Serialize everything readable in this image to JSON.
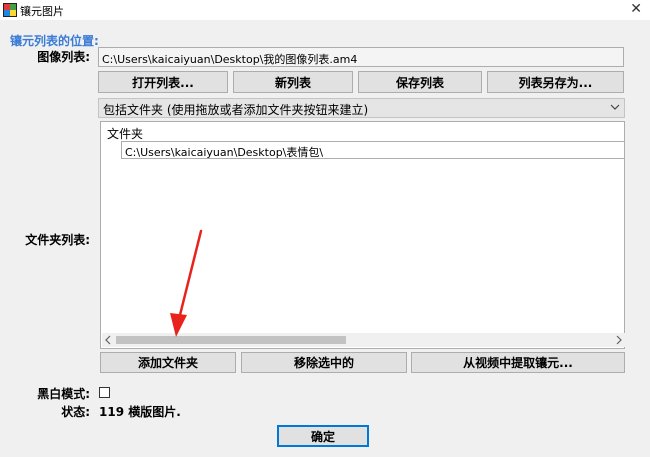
{
  "window": {
    "title": "镶元图片",
    "close_glyph": "✕"
  },
  "group_label": "镶元列表的位置:",
  "image_list": {
    "label": "图像列表:",
    "path": "C:\\Users\\kaicaiyuan\\Desktop\\我的图像列表.am4"
  },
  "list_buttons": {
    "open": "打开列表...",
    "new": "新列表",
    "save": "保存列表",
    "save_as": "列表另存为..."
  },
  "folder_combo": {
    "selected": "包括文件夹 (使用拖放或者添加文件夹按钮来建立)"
  },
  "folder_list": {
    "label": "文件夹列表:",
    "column_header": "文件夹",
    "rows": [
      "C:\\Users\\kaicaiyuan\\Desktop\\表情包\\"
    ]
  },
  "folder_buttons": {
    "add": "添加文件夹",
    "remove": "移除选中的",
    "extract": "从视频中提取镶元..."
  },
  "bw_mode": {
    "label": "黑白模式:"
  },
  "status": {
    "label": "状态:",
    "value": "119 横版图片."
  },
  "ok_button": "确定",
  "icons": {
    "app": "app-icon",
    "close": "close-icon",
    "dropdown": "chevron-down-icon",
    "scroll_left": "scroll-left-icon",
    "scroll_right": "scroll-right-icon",
    "annotation": "red-arrow-icon"
  },
  "colors": {
    "accent_label": "#3a7bd5",
    "annotation_arrow": "#e8231c",
    "primary_border": "#0078d7"
  }
}
